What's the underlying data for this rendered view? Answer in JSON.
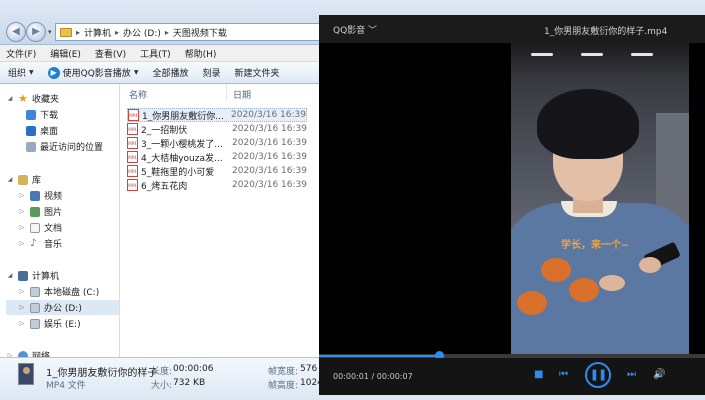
{
  "explorer": {
    "breadcrumb": [
      "计算机",
      "办公 (D:)",
      "天图视频下载"
    ],
    "menu": [
      "文件(F)",
      "编辑(E)",
      "查看(V)",
      "工具(T)",
      "帮助(H)"
    ],
    "toolbar": {
      "organize": "组织",
      "play_with": "使用QQ影音播放",
      "play_all": "全部播放",
      "burn": "刻录",
      "new_folder": "新建文件夹"
    },
    "nav": {
      "favorites": "收藏夹",
      "downloads": "下载",
      "desktop": "桌面",
      "recent": "最近访问的位置",
      "libraries": "库",
      "videos": "视频",
      "pictures": "图片",
      "documents": "文档",
      "music": "音乐",
      "computer": "计算机",
      "drive_c": "本地磁盘 (C:)",
      "drive_d": "办公 (D:)",
      "drive_e": "娱乐 (E:)",
      "network": "网络"
    },
    "columns": {
      "name": "名称",
      "date": "日期"
    },
    "files": [
      {
        "name": "1_你男朋友敷衍你...",
        "date": "2020/3/16 16:39"
      },
      {
        "name": "2_一招制伏",
        "date": "2020/3/16 16:39"
      },
      {
        "name": "3_一颗小樱桃发了...",
        "date": "2020/3/16 16:39"
      },
      {
        "name": "4_大桔柚youza发...",
        "date": "2020/3/16 16:39"
      },
      {
        "name": "5_鞋拖里的小可爱",
        "date": "2020/3/16 16:39"
      },
      {
        "name": "6_烤五花肉",
        "date": "2020/3/16 16:39"
      }
    ],
    "details": {
      "filename": "1_你男朋友敷衍你的样子",
      "filetype": "MP4 文件",
      "length_label": "长度:",
      "length_value": "00:00:06",
      "size_label": "大小:",
      "size_value": "732 KB",
      "frame_w_label": "帧宽度:",
      "frame_w_value": "576",
      "frame_h_label": "帧高度:",
      "frame_h_value": "1024"
    }
  },
  "player": {
    "brand": "QQ影音",
    "title": "1_你男朋友敷衍你的样子.mp4",
    "video_caption": "学长，来一个~",
    "current_time": "00:00:01",
    "total_time": "00:00:07",
    "progress": 0.31,
    "accent_color": "#2b8cf2"
  }
}
